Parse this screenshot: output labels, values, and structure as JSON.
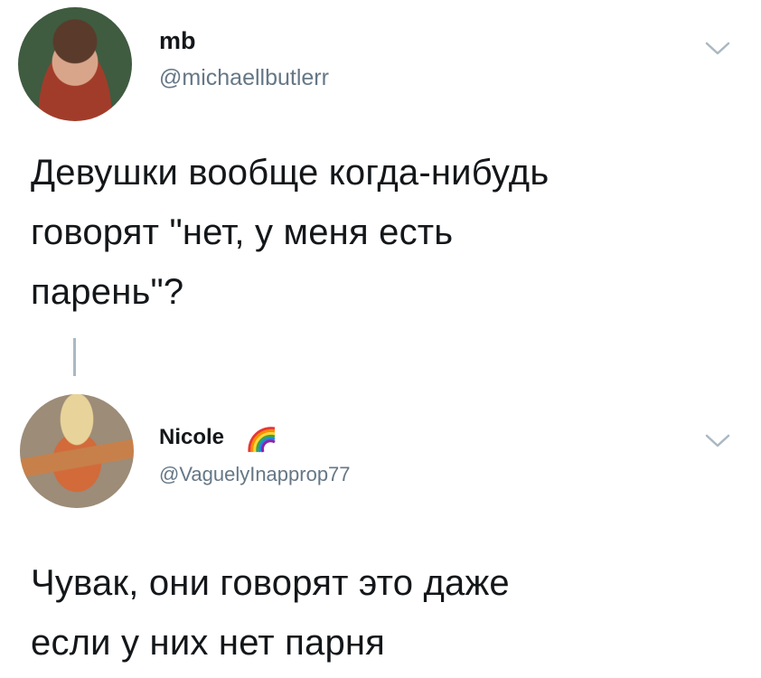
{
  "tweets": [
    {
      "display_name": "mb",
      "handle": "@michaellbutlerr",
      "text_lines": [
        "Девушки вообще когда-нибудь",
        "говорят \"нет, у меня есть",
        "парень\"?"
      ],
      "avatar_icon": "avatar-photo",
      "menu_icon": "chevron-down-icon"
    },
    {
      "display_name": "Nicole",
      "badge_icon": "rainbow-icon",
      "handle": "@VaguelyInapprop77",
      "text_lines": [
        "Чувак, они говорят это даже",
        "если у них нет парня"
      ],
      "avatar_icon": "avatar-photo",
      "menu_icon": "chevron-down-icon"
    }
  ],
  "colors": {
    "text": "#14171a",
    "secondary": "#657786",
    "thread_line": "#aab8c2",
    "background": "#ffffff"
  }
}
